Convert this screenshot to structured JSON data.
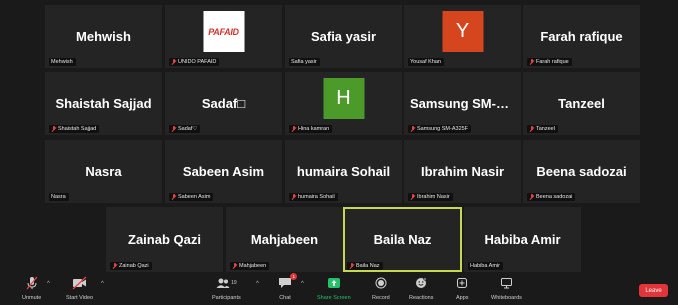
{
  "tiles": [
    {
      "name": "Mehwish",
      "label": "Mehwish",
      "muted": false
    },
    {
      "name": "",
      "label": "UNIDO PAFAID",
      "muted": true,
      "logo_text": "PAFAID"
    },
    {
      "name": "Safia yasir",
      "label": "Safia yasir",
      "muted": false
    },
    {
      "name": "",
      "label": "Yousaf Khan",
      "muted": false,
      "avatar_letter": "Y",
      "avatar_color": "#d5461f"
    },
    {
      "name": "Farah rafique",
      "label": "Farah rafique",
      "muted": true
    },
    {
      "name": "Shaistah Sajjad",
      "label": "Shaistah Sajjad",
      "muted": true
    },
    {
      "name": "Sadaf□",
      "label": "Sadaf♡",
      "muted": true
    },
    {
      "name": "",
      "label": "Hina kamran",
      "muted": true,
      "avatar_letter": "H",
      "avatar_color": "#4c9a2a"
    },
    {
      "name": "Samsung SM-A...",
      "label": "Samsung SM-A325F",
      "muted": true
    },
    {
      "name": "Tanzeel",
      "label": "Tanzeel",
      "muted": true
    },
    {
      "name": "Nasra",
      "label": "Nasra",
      "muted": false
    },
    {
      "name": "Sabeen Asim",
      "label": "Sabeen Asim",
      "muted": true
    },
    {
      "name": "humaira Sohail",
      "label": "humaira Sohail",
      "muted": true
    },
    {
      "name": "Ibrahim Nasir",
      "label": "Ibrahim Nasir",
      "muted": true
    },
    {
      "name": "Beena sadozai",
      "label": "Beena sadozai",
      "muted": true
    },
    {
      "name": "Zainab Qazi",
      "label": "Zainab Qazi",
      "muted": true
    },
    {
      "name": "Mahjabeen",
      "label": "Mahjabeen",
      "muted": true
    },
    {
      "name": "Baila Naz",
      "label": "Baila Naz",
      "muted": true,
      "active": true
    },
    {
      "name": "Habiba Amir",
      "label": "Habiba Amir",
      "muted": false
    }
  ],
  "toolbar": {
    "unmute": "Unmute",
    "start_video": "Start Video",
    "participants": "Participants",
    "participants_count": "19",
    "chat": "Chat",
    "chat_badge": "1",
    "share_screen": "Share Screen",
    "record": "Record",
    "reactions": "Reactions",
    "apps": "Apps",
    "whiteboards": "Whiteboards",
    "leave": "Leave"
  },
  "colors": {
    "background": "#1a1a1a",
    "tile": "#242424",
    "active_border": "#c5d84e",
    "share_green": "#25c16a",
    "leave_red": "#e2353a",
    "muted_red": "#e94343"
  },
  "icons": [
    "mic-off-icon",
    "video-off-icon",
    "participants-icon",
    "chat-icon",
    "share-screen-icon",
    "record-icon",
    "reactions-icon",
    "apps-icon",
    "whiteboards-icon"
  ]
}
